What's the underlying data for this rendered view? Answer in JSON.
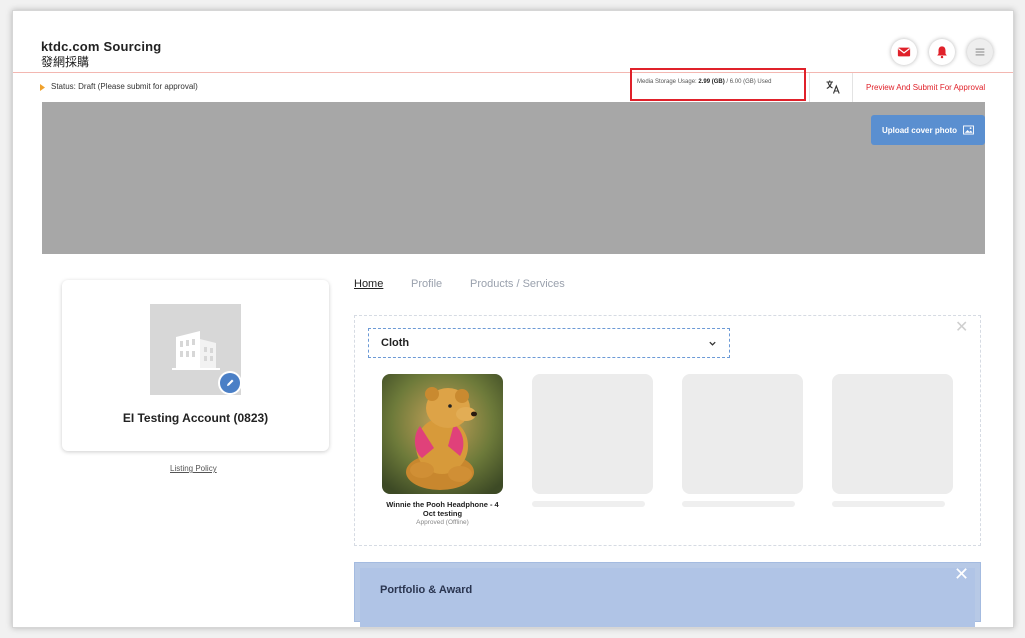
{
  "header": {
    "title": "ktdc.com Sourcing",
    "subtitle": "發網採購",
    "icons": [
      "mail-icon",
      "bell-icon",
      "menu-icon"
    ]
  },
  "statusbar": {
    "status": "Status: Draft (Please submit for approval)",
    "media_label": "Media Storage Usage:",
    "media_used": "2.99 (GB)",
    "media_total": "/ 6.00 (GB) Used",
    "preview_submit": "Preview And Submit For Approval"
  },
  "cover": {
    "upload_label": "Upload cover photo"
  },
  "profile": {
    "account_name": "EI Testing Account (0823)",
    "listing_policy": "Listing Policy"
  },
  "tabs": [
    {
      "label": "Home",
      "active": true
    },
    {
      "label": "Profile",
      "active": false
    },
    {
      "label": "Products / Services",
      "active": false
    }
  ],
  "category_panel": {
    "selected_category": "Cloth",
    "products": [
      {
        "name": "Winnie the Pooh Headphone - 4 Oct testing",
        "status": "Approved (Offline)"
      }
    ]
  },
  "portfolio": {
    "title": "Portfolio & Award"
  },
  "colors": {
    "accent_red": "#e0212a",
    "accent_blue": "#5a8fd0",
    "cover_gray": "#a7a7a7"
  }
}
